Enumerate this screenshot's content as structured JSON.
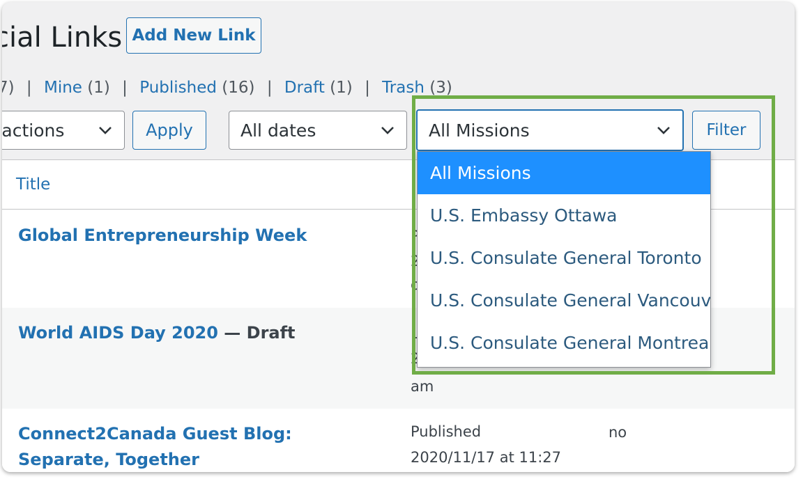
{
  "page": {
    "title": "cial Links",
    "add_new_label": "Add New Link"
  },
  "status_filters": [
    {
      "label": "",
      "count": "7)"
    },
    {
      "label": "Mine",
      "count": "(1)"
    },
    {
      "label": "Published",
      "count": "(16)"
    },
    {
      "label": "Draft",
      "count": "(1)"
    },
    {
      "label": "Trash",
      "count": "(3)"
    }
  ],
  "toolbar": {
    "bulk_actions": "k actions",
    "apply_label": "Apply",
    "dates": "All dates",
    "missions": "All Missions",
    "filter_label": "Filter"
  },
  "missions_dropdown": {
    "options": [
      "All Missions",
      "U.S. Embassy Ottawa",
      "U.S. Consulate General Toronto",
      "U.S. Consulate General Vancouver",
      "U.S. Consulate General Montreal"
    ],
    "selected": "All Missions"
  },
  "table": {
    "header_title": "Title",
    "rows": [
      {
        "title": "Global Entrepreneurship Week",
        "state": "",
        "col_status_fragments": [
          "P",
          "2",
          "c"
        ],
        "date": "",
        "flag": ""
      },
      {
        "title": "World AIDS Day 2020",
        "state": " — Draft",
        "col_status_fragments": [
          "L",
          "2",
          "am"
        ],
        "date": "",
        "flag": ""
      },
      {
        "title": "Connect2Canada Guest Blog: Separate, Together",
        "state": "",
        "status": "Published",
        "date": "2020/11/17 at 11:27",
        "flag": "no"
      }
    ]
  },
  "colors": {
    "link": "#2271b1",
    "selected_option": "#1e90ff",
    "highlight_border": "#70ad47"
  }
}
